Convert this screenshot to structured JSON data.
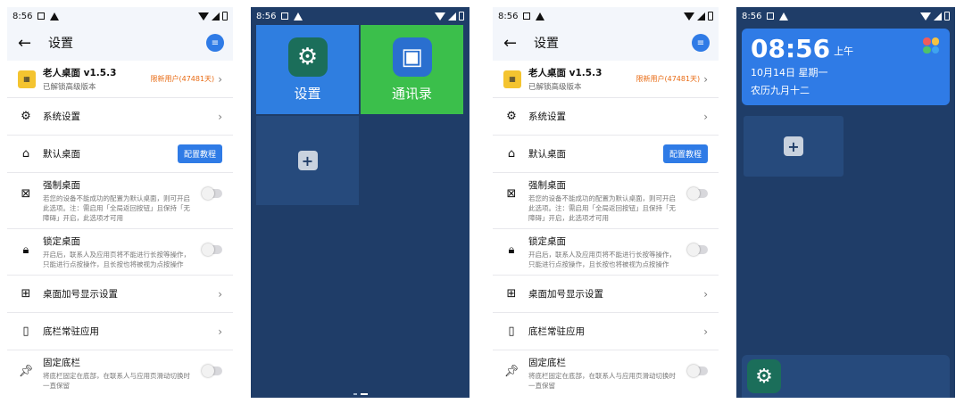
{
  "status": {
    "time": "8:56"
  },
  "settings_screen": {
    "title": "设置",
    "back_icon": "arrow-back-icon",
    "help_icon": "help-icon",
    "app_row": {
      "name": "老人桌面 v1.5.3",
      "subtitle": "已解锁高级版本",
      "badge": "限新用户(47481天)"
    },
    "rows": {
      "system_settings": "系统设置",
      "default_desktop": "默认桌面",
      "config_button": "配置教程",
      "force_desktop": {
        "title": "强制桌面",
        "desc": "若您的设备不能成功的配置为默认桌面，则可开启此选项。注：需启用「全局返回按钮」且保持「无障碍」开启，此选项才可用",
        "on": false
      },
      "lock_desktop": {
        "title": "锁定桌面",
        "desc": "开启后，联系人及应用页将不能进行长按等操作，只能进行点按操作，且长按也将被视为点按操作",
        "on": false
      },
      "plus_display": "桌面加号显示设置",
      "dock_apps": "底栏常驻应用",
      "fixed_dock": {
        "title": "固定底栏",
        "desc": "将底栏固定在底部，在联系人与应用页滑动切换时一直保留",
        "on": false
      }
    }
  },
  "tile_screen": {
    "tiles": [
      {
        "label": "设置",
        "icon": "gear-icon",
        "color": "#2f7ee0",
        "icon_bg": "#1b6e5a"
      },
      {
        "label": "通讯录",
        "icon": "contacts-icon",
        "color": "#3bbf4b",
        "icon_bg": "#2a6fcf"
      }
    ]
  },
  "clock_screen": {
    "time": "08:56",
    "ampm": "上午",
    "date": "10月14日  星期一",
    "lunar": "农历九月十二"
  },
  "colors": {
    "accent": "#2f7be6",
    "dark_bg": "#1f3d68",
    "badge": "#e86a12"
  }
}
